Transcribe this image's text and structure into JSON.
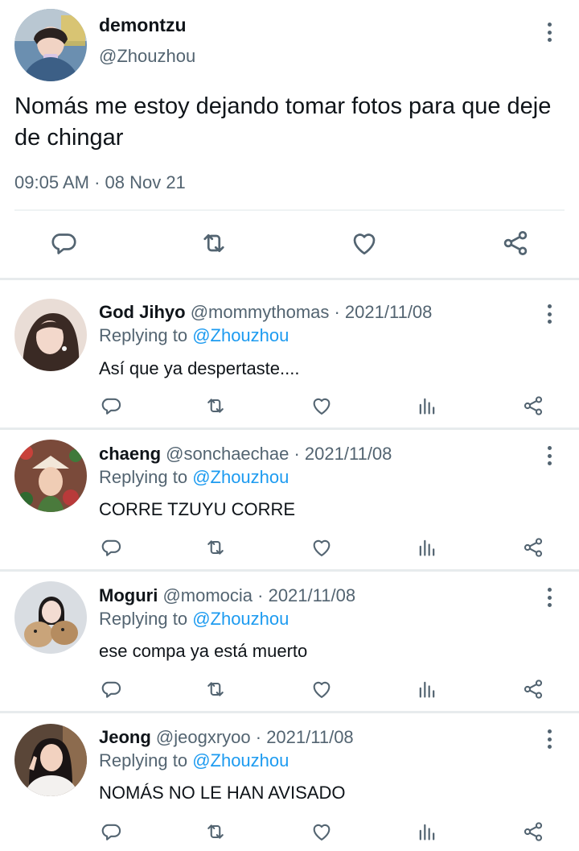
{
  "main_tweet": {
    "display_name": "demontzu",
    "handle": "@Zhouzhou",
    "text": "Nomás me estoy dejando tomar fotos para que deje de chingar",
    "timestamp": "09:05 AM · 08 Nov 21",
    "actions": [
      "reply-icon",
      "retweet-icon",
      "like-icon",
      "share-icon"
    ]
  },
  "replies": [
    {
      "display_name": "God Jihyo",
      "meta": "@mommythomas · 2021/11/08",
      "replying_prefix": "Replying to ",
      "replying_to": "@Zhouzhou",
      "text": "Así que ya despertaste...."
    },
    {
      "display_name": "chaeng",
      "meta": "@sonchaechae · 2021/11/08",
      "replying_prefix": "Replying to ",
      "replying_to": "@Zhouzhou",
      "text": "CORRE TZUYU CORRE"
    },
    {
      "display_name": "Moguri",
      "meta": "@momocia · 2021/11/08",
      "replying_prefix": "Replying to ",
      "replying_to": "@Zhouzhou",
      "text": "ese compa ya está muerto"
    },
    {
      "display_name": "Jeong",
      "meta": "@jeogxryoo · 2021/11/08",
      "replying_prefix": "Replying to ",
      "replying_to": "@Zhouzhou",
      "text": "NOMÁS NO LE HAN AVISADO"
    }
  ],
  "colors": {
    "text": "#0f1419",
    "secondary": "#536471",
    "link": "#1d9bf0",
    "separator": "#e7ebed"
  }
}
